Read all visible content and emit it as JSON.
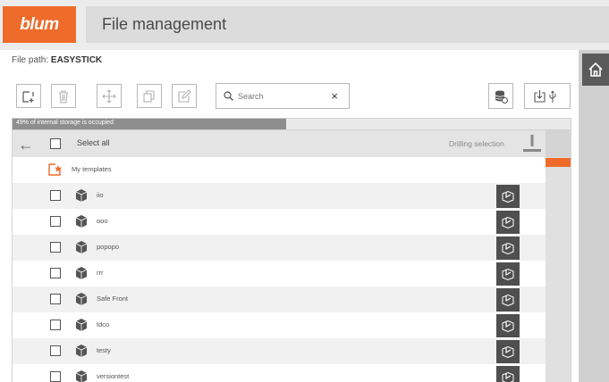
{
  "header": {
    "logo_text": "blum",
    "title": "File management"
  },
  "filepath": {
    "label": "File path:",
    "value": "EASYSTICK"
  },
  "toolbar": {
    "buttons": [
      {
        "name": "new-file-button",
        "icon": "new-file-icon",
        "enabled": true
      },
      {
        "name": "delete-button",
        "icon": "trash-icon",
        "enabled": false
      },
      {
        "name": "move-button",
        "icon": "move-icon",
        "enabled": false
      },
      {
        "name": "copy-button",
        "icon": "copy-icon",
        "enabled": false
      },
      {
        "name": "rename-button",
        "icon": "edit-icon",
        "enabled": false
      }
    ],
    "search_placeholder": "Search",
    "clear": "×",
    "right_buttons": [
      {
        "name": "storage-switch-button",
        "icon": "database-icon"
      },
      {
        "name": "usb-import-button",
        "icon": "usb-icon"
      }
    ]
  },
  "storage": {
    "text": "49% of internal storage is occupied",
    "percent": 49
  },
  "list": {
    "select_all": "Select all",
    "drilling_selection": "Drilling selection",
    "folder": {
      "name": "My templates",
      "icon": "template-folder-icon"
    },
    "items": [
      {
        "name": "iio"
      },
      {
        "name": "ooo"
      },
      {
        "name": "popopo"
      },
      {
        "name": "rrr"
      },
      {
        "name": "Safe Front"
      },
      {
        "name": "tdco"
      },
      {
        "name": "testy"
      },
      {
        "name": "versiontest"
      }
    ]
  },
  "colors": {
    "brand": "#ee6b2a",
    "action_bg": "#4f4f4f",
    "header_bg": "#e4e4e4"
  }
}
